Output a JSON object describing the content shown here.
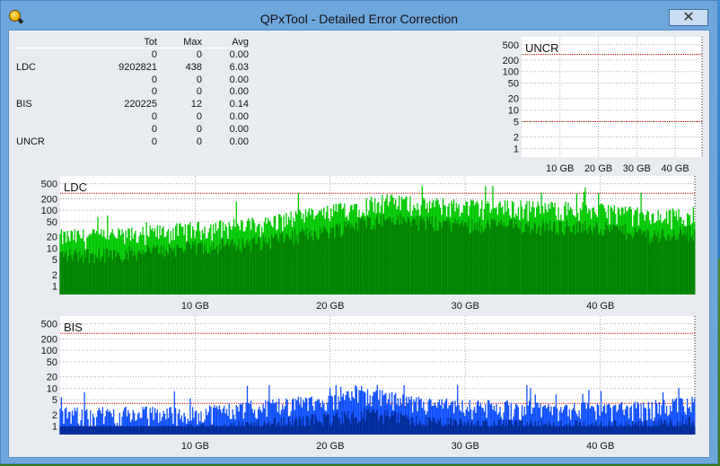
{
  "window": {
    "title": "QPxTool - Detailed Error Correction",
    "close_glyph": "✕"
  },
  "stats": {
    "headers": [
      "",
      "Tot",
      "Max",
      "Avg"
    ],
    "rows": [
      [
        "",
        "0",
        "0",
        "0.00"
      ],
      [
        "LDC",
        "9202821",
        "438",
        "6.03"
      ],
      [
        "",
        "0",
        "0",
        "0.00"
      ],
      [
        "",
        "0",
        "0",
        "0.00"
      ],
      [
        "BIS",
        "220225",
        "12",
        "0.14"
      ],
      [
        "",
        "0",
        "0",
        "0.00"
      ],
      [
        "",
        "0",
        "0",
        "0.00"
      ],
      [
        "UNCR",
        "0",
        "0",
        "0.00"
      ]
    ]
  },
  "chart_data": [
    {
      "type": "bar",
      "title": "UNCR",
      "y_scale": "log",
      "y_ticks": [
        1,
        2,
        5,
        10,
        20,
        50,
        100,
        200,
        500
      ],
      "x_ticks": [
        "10 GB",
        "20 GB",
        "30 GB",
        "40 GB"
      ],
      "x_range_gb": [
        0,
        47
      ],
      "threshold_lines": [
        5,
        280
      ],
      "series": [
        {
          "values": [
            0
          ]
        }
      ],
      "color": "#ff0000"
    },
    {
      "type": "bar",
      "title": "LDC",
      "y_scale": "log",
      "y_ticks": [
        1,
        2,
        5,
        10,
        20,
        50,
        100,
        200,
        500
      ],
      "x_ticks": [
        "10 GB",
        "20 GB",
        "30 GB",
        "40 GB"
      ],
      "x_range_gb": [
        0,
        47
      ],
      "threshold_lines": [
        4,
        280
      ],
      "max": 438,
      "typical_profile_gb": [
        [
          0,
          25
        ],
        [
          5,
          28
        ],
        [
          10,
          40
        ],
        [
          15,
          55
        ],
        [
          20,
          110
        ],
        [
          22,
          170
        ],
        [
          24,
          220
        ],
        [
          28,
          170
        ],
        [
          33,
          150
        ],
        [
          38,
          140
        ],
        [
          41,
          120
        ],
        [
          44,
          80
        ],
        [
          46.5,
          100
        ]
      ],
      "color": "#00c800",
      "color_dark": "#007000"
    },
    {
      "type": "bar",
      "title": "BIS",
      "y_scale": "log",
      "y_ticks": [
        1,
        2,
        5,
        10,
        20,
        50,
        100,
        200,
        500
      ],
      "x_ticks": [
        "10 GB",
        "20 GB",
        "30 GB",
        "40 GB"
      ],
      "x_range_gb": [
        0,
        47
      ],
      "threshold_lines": [
        4,
        280
      ],
      "max": 12,
      "typical_profile_gb": [
        [
          0,
          2.5
        ],
        [
          10,
          2.8
        ],
        [
          17,
          4.5
        ],
        [
          20,
          6
        ],
        [
          23,
          8
        ],
        [
          26,
          5
        ],
        [
          30,
          4
        ],
        [
          35,
          3.8
        ],
        [
          40,
          3.5
        ],
        [
          44,
          3.8
        ],
        [
          46.5,
          5
        ]
      ],
      "color": "#1050ff",
      "color_dark": "#002080"
    }
  ]
}
